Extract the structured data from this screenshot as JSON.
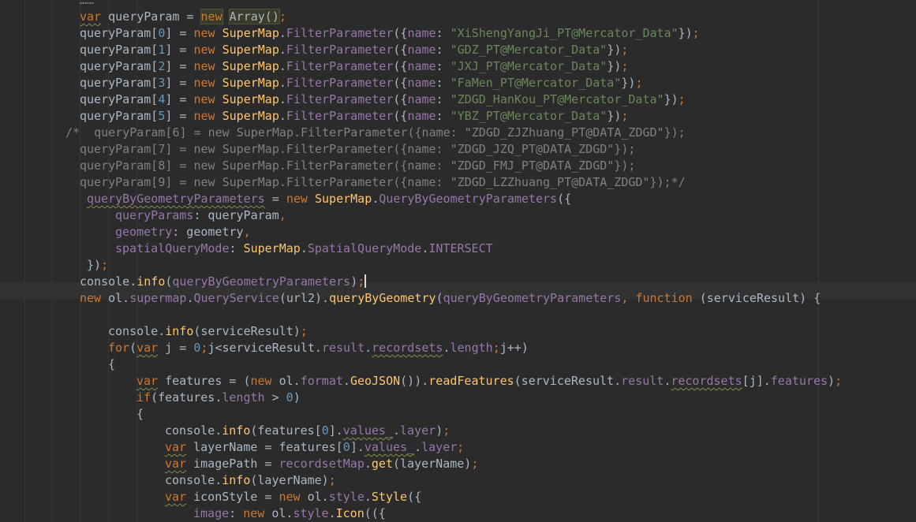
{
  "editor": {
    "theme_colors": {
      "background": "#2b2b2b",
      "keyword": "#cc7832",
      "function": "#ffc66d",
      "property": "#9876aa",
      "string": "#6a8759",
      "number": "#6897bb",
      "comment": "#808080",
      "identifier": "#a9b7c6"
    },
    "lines": [
      {
        "id": "l00",
        "tokens": [
          [
            "com",
            "……"
          ]
        ]
      },
      {
        "id": "l01",
        "tokens": [
          [
            "kw squig",
            "var"
          ],
          [
            "id",
            " queryParam "
          ],
          [
            "punc",
            "= "
          ],
          [
            "kw hl-bg",
            "new"
          ],
          [
            "id",
            " "
          ],
          [
            "id hl-bg",
            "Array()"
          ],
          [
            "semi",
            ";"
          ]
        ]
      },
      {
        "id": "l02",
        "tokens": [
          [
            "id",
            "queryParam["
          ],
          [
            "num",
            "0"
          ],
          [
            "id",
            "] = "
          ],
          [
            "kw",
            "new "
          ],
          [
            "cls",
            "SuperMap"
          ],
          [
            "id",
            "."
          ],
          [
            "prop",
            "FilterParameter"
          ],
          [
            "id",
            "({"
          ],
          [
            "prop",
            "name"
          ],
          [
            "id",
            ": "
          ],
          [
            "str",
            "\"XiShengYangJi_PT@Mercator_Data\""
          ],
          [
            "id",
            "})"
          ],
          [
            "semi",
            ";"
          ]
        ]
      },
      {
        "id": "l03",
        "tokens": [
          [
            "id",
            "queryParam["
          ],
          [
            "num",
            "1"
          ],
          [
            "id",
            "] = "
          ],
          [
            "kw",
            "new "
          ],
          [
            "cls",
            "SuperMap"
          ],
          [
            "id",
            "."
          ],
          [
            "prop",
            "FilterParameter"
          ],
          [
            "id",
            "({"
          ],
          [
            "prop",
            "name"
          ],
          [
            "id",
            ": "
          ],
          [
            "str",
            "\"GDZ_PT@Mercator_Data\""
          ],
          [
            "id",
            "})"
          ],
          [
            "semi",
            ";"
          ]
        ]
      },
      {
        "id": "l04",
        "tokens": [
          [
            "id",
            "queryParam["
          ],
          [
            "num",
            "2"
          ],
          [
            "id",
            "] = "
          ],
          [
            "kw",
            "new "
          ],
          [
            "cls",
            "SuperMap"
          ],
          [
            "id",
            "."
          ],
          [
            "prop",
            "FilterParameter"
          ],
          [
            "id",
            "({"
          ],
          [
            "prop",
            "name"
          ],
          [
            "id",
            ": "
          ],
          [
            "str",
            "\"JXJ_PT@Mercator_Data\""
          ],
          [
            "id",
            "})"
          ],
          [
            "semi",
            ";"
          ]
        ]
      },
      {
        "id": "l05",
        "tokens": [
          [
            "id",
            "queryParam["
          ],
          [
            "num",
            "3"
          ],
          [
            "id",
            "] = "
          ],
          [
            "kw",
            "new "
          ],
          [
            "cls",
            "SuperMap"
          ],
          [
            "id",
            "."
          ],
          [
            "prop",
            "FilterParameter"
          ],
          [
            "id",
            "({"
          ],
          [
            "prop",
            "name"
          ],
          [
            "id",
            ": "
          ],
          [
            "str",
            "\"FaMen_PT@Mercator_Data\""
          ],
          [
            "id",
            "})"
          ],
          [
            "semi",
            ";"
          ]
        ]
      },
      {
        "id": "l06",
        "tokens": [
          [
            "id",
            "queryParam["
          ],
          [
            "num",
            "4"
          ],
          [
            "id",
            "] = "
          ],
          [
            "kw",
            "new "
          ],
          [
            "cls",
            "SuperMap"
          ],
          [
            "id",
            "."
          ],
          [
            "prop",
            "FilterParameter"
          ],
          [
            "id",
            "({"
          ],
          [
            "prop",
            "name"
          ],
          [
            "id",
            ": "
          ],
          [
            "str",
            "\"ZDGD_HanKou_PT@Mercator_Data\""
          ],
          [
            "id",
            "})"
          ],
          [
            "semi",
            ";"
          ]
        ]
      },
      {
        "id": "l07",
        "tokens": [
          [
            "id",
            "queryParam["
          ],
          [
            "num",
            "5"
          ],
          [
            "id",
            "] = "
          ],
          [
            "kw",
            "new "
          ],
          [
            "cls",
            "SuperMap"
          ],
          [
            "id",
            "."
          ],
          [
            "prop",
            "FilterParameter"
          ],
          [
            "id",
            "({"
          ],
          [
            "prop",
            "name"
          ],
          [
            "id",
            ": "
          ],
          [
            "str",
            "\"YBZ_PT@Mercator_Data\""
          ],
          [
            "id",
            "})"
          ],
          [
            "semi",
            ";"
          ]
        ]
      },
      {
        "id": "l08",
        "tokens": [
          [
            "com",
            "/*  queryParam[6] = new SuperMap.FilterParameter({name: \"ZDGD_ZJZhuang_PT@DATA_ZDGD\"});"
          ]
        ]
      },
      {
        "id": "l09",
        "tokens": [
          [
            "com",
            "queryParam[7] = new SuperMap.FilterParameter({name: \"ZDGD_JZQ_PT@DATA_ZDGD\"});"
          ]
        ]
      },
      {
        "id": "l10",
        "tokens": [
          [
            "com",
            "queryParam[8] = new SuperMap.FilterParameter({name: \"ZDGD_FMJ_PT@DATA_ZDGD\"});"
          ]
        ]
      },
      {
        "id": "l11",
        "tokens": [
          [
            "com",
            "queryParam[9] = new SuperMap.FilterParameter({name: \"ZDGD_LZZhuang_PT@DATA_ZDGD\"});*/"
          ]
        ]
      },
      {
        "id": "l12",
        "tokens": [
          [
            "prop squig",
            "queryByGeometryParameters"
          ],
          [
            "id",
            " = "
          ],
          [
            "kw",
            "new "
          ],
          [
            "cls",
            "SuperMap"
          ],
          [
            "id",
            "."
          ],
          [
            "prop",
            "QueryByGeometryParameters"
          ],
          [
            "id",
            "({"
          ]
        ]
      },
      {
        "id": "l13",
        "tokens": [
          [
            "prop",
            "queryParams"
          ],
          [
            "id",
            ": queryParam"
          ],
          [
            "semi",
            ","
          ]
        ]
      },
      {
        "id": "l14",
        "tokens": [
          [
            "prop",
            "geometry"
          ],
          [
            "id",
            ": geometry"
          ],
          [
            "semi",
            ","
          ]
        ]
      },
      {
        "id": "l15",
        "tokens": [
          [
            "prop",
            "spatialQueryMode"
          ],
          [
            "id",
            ": "
          ],
          [
            "cls",
            "SuperMap"
          ],
          [
            "id",
            "."
          ],
          [
            "prop",
            "SpatialQueryMode"
          ],
          [
            "id",
            "."
          ],
          [
            "prop",
            "INTERSECT"
          ]
        ]
      },
      {
        "id": "l16",
        "tokens": [
          [
            "id",
            "})"
          ],
          [
            "semi",
            ";"
          ]
        ]
      },
      {
        "id": "l17",
        "tokens": [
          [
            "id",
            "console."
          ],
          [
            "fn",
            "info"
          ],
          [
            "id",
            "("
          ],
          [
            "prop",
            "queryByGeometryParameters"
          ],
          [
            "id",
            ")"
          ],
          [
            "semi",
            ";"
          ]
        ]
      },
      {
        "id": "l18",
        "tokens": [
          [
            "kw",
            "new "
          ],
          [
            "id",
            "ol."
          ],
          [
            "prop",
            "supermap"
          ],
          [
            "id",
            "."
          ],
          [
            "prop",
            "QueryService"
          ],
          [
            "id",
            "(url2)."
          ],
          [
            "fn",
            "queryByGeometry"
          ],
          [
            "id",
            "("
          ],
          [
            "prop",
            "queryByGeometryParameters"
          ],
          [
            "semi",
            ", "
          ],
          [
            "kw",
            "function "
          ],
          [
            "id",
            "(serviceResult) {"
          ]
        ]
      },
      {
        "id": "l19",
        "tokens": []
      },
      {
        "id": "l20",
        "tokens": [
          [
            "id",
            "console."
          ],
          [
            "fn",
            "info"
          ],
          [
            "id",
            "(serviceResult)"
          ],
          [
            "semi",
            ";"
          ]
        ]
      },
      {
        "id": "l21",
        "tokens": [
          [
            "kw",
            "for"
          ],
          [
            "id",
            "("
          ],
          [
            "kw squig",
            "var"
          ],
          [
            "id",
            " j = "
          ],
          [
            "num",
            "0"
          ],
          [
            "semi",
            ";"
          ],
          [
            "id",
            "j<serviceResult."
          ],
          [
            "prop",
            "result"
          ],
          [
            "id",
            "."
          ],
          [
            "prop squig",
            "recordsets"
          ],
          [
            "id",
            "."
          ],
          [
            "prop",
            "length"
          ],
          [
            "semi",
            ";"
          ],
          [
            "id",
            "j++)"
          ]
        ]
      },
      {
        "id": "l22",
        "tokens": [
          [
            "id",
            "{"
          ]
        ]
      },
      {
        "id": "l23",
        "tokens": [
          [
            "kw squig",
            "var"
          ],
          [
            "id",
            " features = ("
          ],
          [
            "kw",
            "new "
          ],
          [
            "id",
            "ol."
          ],
          [
            "prop",
            "format"
          ],
          [
            "id",
            "."
          ],
          [
            "fn",
            "GeoJSON"
          ],
          [
            "id",
            "())."
          ],
          [
            "fn",
            "readFeatures"
          ],
          [
            "id",
            "(serviceResult."
          ],
          [
            "prop",
            "result"
          ],
          [
            "id",
            "."
          ],
          [
            "prop squig",
            "recordsets"
          ],
          [
            "id",
            "[j]."
          ],
          [
            "prop",
            "features"
          ],
          [
            "id",
            ")"
          ],
          [
            "semi",
            ";"
          ]
        ]
      },
      {
        "id": "l24",
        "tokens": [
          [
            "kw",
            "if"
          ],
          [
            "id",
            "(features."
          ],
          [
            "prop",
            "length"
          ],
          [
            "id",
            " > "
          ],
          [
            "num",
            "0"
          ],
          [
            "id",
            ")"
          ]
        ]
      },
      {
        "id": "l25",
        "tokens": [
          [
            "id",
            "{"
          ]
        ]
      },
      {
        "id": "l26",
        "tokens": [
          [
            "id",
            "console."
          ],
          [
            "fn",
            "info"
          ],
          [
            "id",
            "(features["
          ],
          [
            "num",
            "0"
          ],
          [
            "id",
            "]."
          ],
          [
            "prop squig",
            "values_"
          ],
          [
            "id",
            "."
          ],
          [
            "prop",
            "layer"
          ],
          [
            "id",
            ")"
          ],
          [
            "semi",
            ";"
          ]
        ]
      },
      {
        "id": "l27",
        "tokens": [
          [
            "kw squig",
            "var"
          ],
          [
            "id",
            " layerName = features["
          ],
          [
            "num",
            "0"
          ],
          [
            "id",
            "]."
          ],
          [
            "prop squig",
            "values_"
          ],
          [
            "id",
            "."
          ],
          [
            "prop",
            "layer"
          ],
          [
            "semi",
            ";"
          ]
        ]
      },
      {
        "id": "l28",
        "tokens": [
          [
            "kw squig",
            "var"
          ],
          [
            "id",
            " imagePath = "
          ],
          [
            "prop",
            "recordsetMap"
          ],
          [
            "id",
            "."
          ],
          [
            "fn",
            "get"
          ],
          [
            "id",
            "(layerName)"
          ],
          [
            "semi",
            ";"
          ]
        ]
      },
      {
        "id": "l29",
        "tokens": [
          [
            "id",
            "console."
          ],
          [
            "fn",
            "info"
          ],
          [
            "id",
            "(layerName)"
          ],
          [
            "semi",
            ";"
          ]
        ]
      },
      {
        "id": "l30",
        "tokens": [
          [
            "kw squig",
            "var"
          ],
          [
            "id",
            " iconStyle = "
          ],
          [
            "kw",
            "new "
          ],
          [
            "id",
            "ol."
          ],
          [
            "prop",
            "style"
          ],
          [
            "id",
            "."
          ],
          [
            "fn",
            "Style"
          ],
          [
            "id",
            "({"
          ]
        ]
      },
      {
        "id": "l31",
        "tokens": [
          [
            "prop",
            "image"
          ],
          [
            "id",
            ": "
          ],
          [
            "kw",
            "new "
          ],
          [
            "id",
            "ol."
          ],
          [
            "prop",
            "style"
          ],
          [
            "id",
            "."
          ],
          [
            "fn",
            "Icon"
          ],
          [
            "id",
            "(({"
          ]
        ]
      }
    ]
  }
}
